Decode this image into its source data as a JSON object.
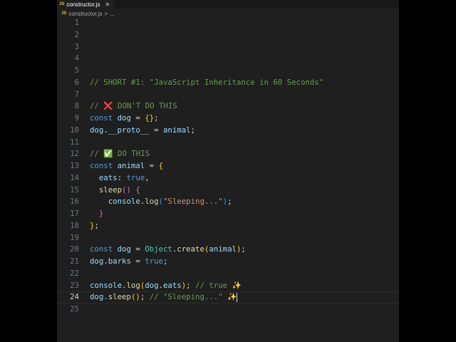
{
  "tab": {
    "icon": "JS",
    "label": "constructor.js",
    "close": "✕"
  },
  "breadcrumb": {
    "icon": "JS",
    "file": "constructor.js",
    "sep": ">",
    "more": "..."
  },
  "current_line": 24,
  "lines": [
    [],
    [],
    [],
    [],
    [],
    [
      [
        "c",
        "// SHORT #1: \"JavaScript Inheritance in 60 Seconds\""
      ]
    ],
    [],
    [
      [
        "c",
        "// ❌ DON'T DO THIS"
      ]
    ],
    [
      [
        "k",
        "const "
      ],
      [
        "v",
        "dog"
      ],
      [
        "p",
        " = "
      ],
      [
        "b1",
        "{}"
      ],
      [
        "p",
        ";"
      ]
    ],
    [
      [
        "v",
        "dog"
      ],
      [
        "p",
        "."
      ],
      [
        "v",
        "__proto__"
      ],
      [
        "p",
        " = "
      ],
      [
        "v",
        "animal"
      ],
      [
        "p",
        ";"
      ]
    ],
    [],
    [
      [
        "c",
        "// ✅ DO THIS"
      ]
    ],
    [
      [
        "k",
        "const "
      ],
      [
        "v",
        "animal"
      ],
      [
        "p",
        " = "
      ],
      [
        "b1",
        "{"
      ]
    ],
    [
      [
        "p",
        "  "
      ],
      [
        "v",
        "eats"
      ],
      [
        "p",
        ": "
      ],
      [
        "k",
        "true"
      ],
      [
        "p",
        ","
      ]
    ],
    [
      [
        "p",
        "  "
      ],
      [
        "f",
        "sleep"
      ],
      [
        "b2",
        "()"
      ],
      [
        "p",
        " "
      ],
      [
        "b2",
        "{"
      ]
    ],
    [
      [
        "p",
        "    "
      ],
      [
        "v",
        "console"
      ],
      [
        "p",
        "."
      ],
      [
        "f",
        "log"
      ],
      [
        "b3",
        "("
      ],
      [
        "s",
        "\"Sleeping...\""
      ],
      [
        "b3",
        ")"
      ],
      [
        "p",
        ";"
      ]
    ],
    [
      [
        "p",
        "  "
      ],
      [
        "b2",
        "}"
      ]
    ],
    [
      [
        "b1",
        "}"
      ],
      [
        "p",
        ";"
      ]
    ],
    [],
    [
      [
        "k",
        "const "
      ],
      [
        "v",
        "dog"
      ],
      [
        "p",
        " = "
      ],
      [
        "t",
        "Object"
      ],
      [
        "p",
        "."
      ],
      [
        "f",
        "create"
      ],
      [
        "b1",
        "("
      ],
      [
        "v",
        "animal"
      ],
      [
        "b1",
        ")"
      ],
      [
        "p",
        ";"
      ]
    ],
    [
      [
        "v",
        "dog"
      ],
      [
        "p",
        "."
      ],
      [
        "v",
        "barks"
      ],
      [
        "p",
        " = "
      ],
      [
        "k",
        "true"
      ],
      [
        "p",
        ";"
      ]
    ],
    [],
    [
      [
        "v",
        "console"
      ],
      [
        "p",
        "."
      ],
      [
        "f",
        "log"
      ],
      [
        "b1",
        "("
      ],
      [
        "v",
        "dog"
      ],
      [
        "p",
        "."
      ],
      [
        "v",
        "eats"
      ],
      [
        "b1",
        ")"
      ],
      [
        "p",
        "; "
      ],
      [
        "c",
        "// true ✨"
      ]
    ],
    [
      [
        "v",
        "dog"
      ],
      [
        "p",
        "."
      ],
      [
        "f",
        "sleep"
      ],
      [
        "b1",
        "()"
      ],
      [
        "p",
        "; "
      ],
      [
        "c",
        "// \"Sleeping...\" ✨"
      ]
    ],
    []
  ]
}
